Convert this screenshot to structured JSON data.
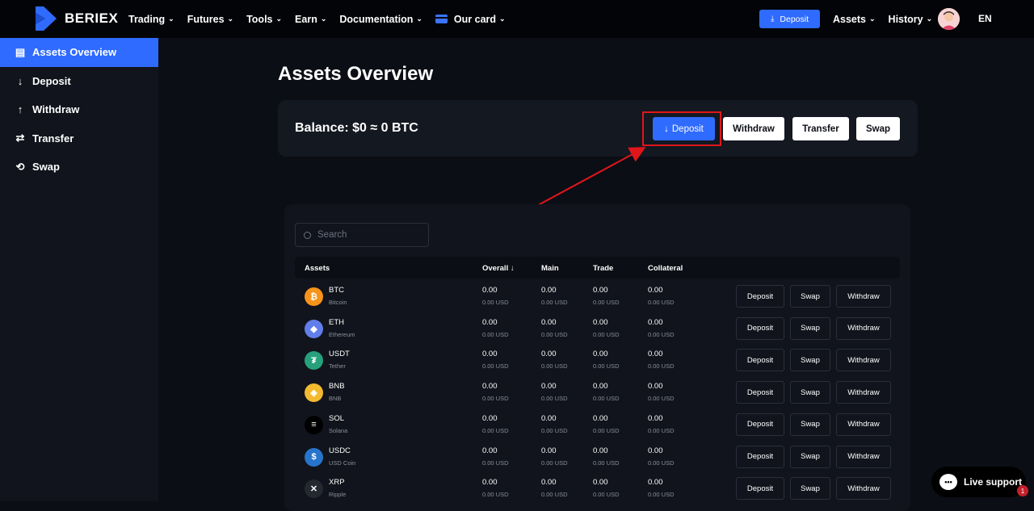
{
  "brand": {
    "name": "BERIEX"
  },
  "nav": {
    "items": [
      {
        "label": "Trading"
      },
      {
        "label": "Futures"
      },
      {
        "label": "Tools"
      },
      {
        "label": "Earn"
      },
      {
        "label": "Documentation"
      },
      {
        "label": "Our card"
      }
    ],
    "deposit_label": "Deposit",
    "assets_label": "Assets",
    "history_label": "History",
    "language": "EN"
  },
  "sidebar": {
    "items": [
      {
        "label": "Assets Overview",
        "icon": "wallet-icon"
      },
      {
        "label": "Deposit",
        "icon": "arrow-down-icon"
      },
      {
        "label": "Withdraw",
        "icon": "arrow-up-icon"
      },
      {
        "label": "Transfer",
        "icon": "transfer-icon"
      },
      {
        "label": "Swap",
        "icon": "swap-icon"
      }
    ]
  },
  "page": {
    "title": "Assets Overview"
  },
  "balance": {
    "text": "Balance: $0 ≈ 0 BTC",
    "deposit_label": "Deposit",
    "withdraw_label": "Withdraw",
    "transfer_label": "Transfer",
    "swap_label": "Swap"
  },
  "search": {
    "placeholder": "Search"
  },
  "table": {
    "headers": {
      "assets": "Assets",
      "overall": "Overall",
      "main": "Main",
      "trade": "Trade",
      "collateral": "Collateral"
    },
    "rows": [
      {
        "symbol": "BTC",
        "name": "Bitcoin",
        "color": "#f7931a",
        "glyph": "₿",
        "overall": "0.00",
        "overall_usd": "0.00 USD",
        "main": "0.00",
        "main_usd": "0.00 USD",
        "trade": "0.00",
        "trade_usd": "0.00 USD",
        "collateral": "0.00",
        "collateral_usd": "0.00 USD",
        "deposit": "Deposit",
        "swap": "Swap",
        "withdraw": "Withdraw"
      },
      {
        "symbol": "ETH",
        "name": "Ethereum",
        "color": "#627eea",
        "glyph": "◆",
        "overall": "0.00",
        "overall_usd": "0.00 USD",
        "main": "0.00",
        "main_usd": "0.00 USD",
        "trade": "0.00",
        "trade_usd": "0.00 USD",
        "collateral": "0.00",
        "collateral_usd": "0.00 USD",
        "deposit": "Deposit",
        "swap": "Swap",
        "withdraw": "Withdraw"
      },
      {
        "symbol": "USDT",
        "name": "Tether",
        "color": "#26a17b",
        "glyph": "₮",
        "overall": "0.00",
        "overall_usd": "0.00 USD",
        "main": "0.00",
        "main_usd": "0.00 USD",
        "trade": "0.00",
        "trade_usd": "0.00 USD",
        "collateral": "0.00",
        "collateral_usd": "0.00 USD",
        "deposit": "Deposit",
        "swap": "Swap",
        "withdraw": "Withdraw"
      },
      {
        "symbol": "BNB",
        "name": "BNB",
        "color": "#f3ba2f",
        "glyph": "◈",
        "overall": "0.00",
        "overall_usd": "0.00 USD",
        "main": "0.00",
        "main_usd": "0.00 USD",
        "trade": "0.00",
        "trade_usd": "0.00 USD",
        "collateral": "0.00",
        "collateral_usd": "0.00 USD",
        "deposit": "Deposit",
        "swap": "Swap",
        "withdraw": "Withdraw"
      },
      {
        "symbol": "SOL",
        "name": "Solana",
        "color": "#000000",
        "glyph": "≡",
        "overall": "0.00",
        "overall_usd": "0.00 USD",
        "main": "0.00",
        "main_usd": "0.00 USD",
        "trade": "0.00",
        "trade_usd": "0.00 USD",
        "collateral": "0.00",
        "collateral_usd": "0.00 USD",
        "deposit": "Deposit",
        "swap": "Swap",
        "withdraw": "Withdraw"
      },
      {
        "symbol": "USDC",
        "name": "USD Coin",
        "color": "#2775ca",
        "glyph": "$",
        "overall": "0.00",
        "overall_usd": "0.00 USD",
        "main": "0.00",
        "main_usd": "0.00 USD",
        "trade": "0.00",
        "trade_usd": "0.00 USD",
        "collateral": "0.00",
        "collateral_usd": "0.00 USD",
        "deposit": "Deposit",
        "swap": "Swap",
        "withdraw": "Withdraw"
      },
      {
        "symbol": "XRP",
        "name": "Ripple",
        "color": "#23292f",
        "glyph": "✕",
        "overall": "0.00",
        "overall_usd": "0.00 USD",
        "main": "0.00",
        "main_usd": "0.00 USD",
        "trade": "0.00",
        "trade_usd": "0.00 USD",
        "collateral": "0.00",
        "collateral_usd": "0.00 USD",
        "deposit": "Deposit",
        "swap": "Swap",
        "withdraw": "Withdraw"
      }
    ]
  },
  "support": {
    "label": "Live support",
    "badge_count": "1"
  },
  "colors": {
    "accent": "#2f6bff",
    "highlight": "#e0161b",
    "background": "#0b0e14"
  }
}
